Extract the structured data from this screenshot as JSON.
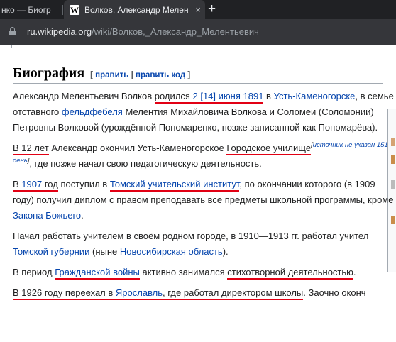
{
  "browser": {
    "tabs": [
      {
        "title": "нко — Биогр",
        "active": false
      },
      {
        "title": "Волков, Александр Мелен",
        "active": true
      }
    ],
    "favicon_letter": "W",
    "close_glyph": "×",
    "new_tab_glyph": "+",
    "url_host": "ru.wikipedia.org",
    "url_path": "/wiki/Волков,_Александр_Мелентьевич"
  },
  "section": {
    "title": "Биография",
    "edit_open": "[ ",
    "edit_link": "править",
    "edit_sep": " | ",
    "edit_code_link": "править код",
    "edit_close": " ]"
  },
  "paragraphs": {
    "p1": {
      "t1": "Александр Мелентьевич Волков ",
      "t2": "родился",
      "t3": " ",
      "t4": "2",
      "t5": " ",
      "t6": "[14] июня",
      "t7": " ",
      "t8": "1891",
      "t9": " в ",
      "t10": "Усть-Каменогорске",
      "t11": ", в семье отставного ",
      "t12": "фельдфебеля",
      "t13": " Мелентия Михайловича Волкова и Соломеи (Соломонии) Петровны Волковой (урождённой Пономаренко, позже записанной как Пономарёва)."
    },
    "p2": {
      "t1": "В 12 лет",
      "t2": " Александр окончил Усть-Каменогорское ",
      "t3": "Городское училище",
      "t4": "[",
      "t5": "источник не указан 151 день",
      "t6": "]",
      "t7": ", где позже начал свою педагогическую деятельность."
    },
    "p3": {
      "t1": "В ",
      "t2": "1907",
      "t3": " год",
      "t4": " поступил в ",
      "t5": "Томский учительский институт",
      "t6": ", по окончании которого (в 1909 году) получил диплом с правом преподавать все предметы школьной программы, кроме ",
      "t7": "Закона Божьего",
      "t8": "."
    },
    "p4": {
      "t1": "Начал работать учителем в своём родном городе, в 1910—1913 гг. работал учител",
      "t2": "Томской губернии",
      "t3": " (ныне ",
      "t4": "Новосибирская область",
      "t5": ")."
    },
    "p5": {
      "t1": "В период ",
      "t2": "Гражданской войны",
      "t3": " активно занимался ",
      "t4": "стихотворной деятельностью",
      "t5": "."
    },
    "p6": {
      "t1": "В 1926 году",
      "t2": " переехал в ",
      "t3": "Ярославль",
      "t4": ", где работал ",
      "t5": "директором школы",
      "t6": ". Заочно оконч"
    }
  },
  "colors": {
    "link": "#0645ad",
    "underline_marker": "#e20014",
    "chrome_dark": "#202124",
    "chrome_mid": "#35363a"
  }
}
